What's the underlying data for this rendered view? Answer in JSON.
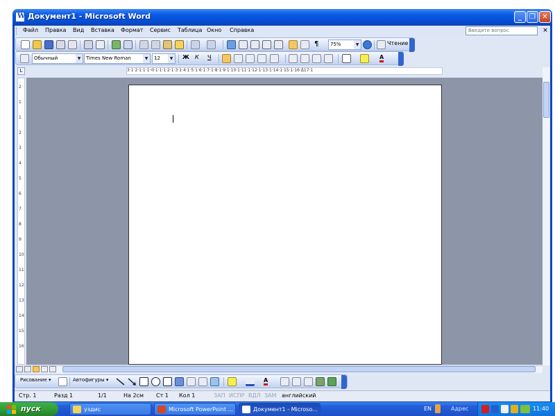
{
  "window": {
    "title": "Документ1 - Microsoft Word",
    "controls": [
      "minimize",
      "restore",
      "close"
    ]
  },
  "menu": {
    "items": [
      "Файл",
      "Правка",
      "Вид",
      "Вставка",
      "Формат",
      "Сервис",
      "Таблица",
      "Окно",
      "Справка"
    ],
    "help_placeholder": "Введите вопрос",
    "close_doc": "×"
  },
  "standard_toolbar": {
    "zoom": "75%",
    "reading_label": "Чтение",
    "pilcrow": "¶"
  },
  "formatting_toolbar": {
    "style": "Обычный",
    "font": "Times New Roman",
    "size": "12",
    "bold": "Ж",
    "italic": "К",
    "underline": "Ч",
    "font_color_glyph": "A"
  },
  "ruler": {
    "tab_selector": "L",
    "horizontal": "3·1·2·1·1·1·ᐊ·1·1·1·2·1·3·1·4·1·5·1·6·1·7·1·8·1·9·1·10·1·11·1·12·1·13·1·14·1·15·1·16·ᐃ17·1",
    "vertical_labels": [
      "2",
      "1",
      "1",
      "2",
      "3",
      "4",
      "5",
      "6",
      "7",
      "8",
      "9",
      "10",
      "11",
      "12",
      "13",
      "14",
      "15",
      "16"
    ]
  },
  "drawing_toolbar": {
    "draw_label": "Рисование ▾",
    "autoshapes_label": "Автофигуры ▾"
  },
  "status_bar": {
    "page": "Стр. 1",
    "section": "Разд 1",
    "pages": "1/1",
    "at": "На 2см",
    "line": "Ст 1",
    "col": "Кол 1",
    "rec": "ЗАП",
    "trk": "ИСПР",
    "ext": "ВДЛ",
    "ovr": "ЗАМ",
    "language": "английский"
  },
  "taskbar": {
    "start_label": "пуск",
    "tasks": [
      {
        "label": "уздис",
        "active": false
      },
      {
        "label": "Microsoft PowerPoint ...",
        "active": false
      },
      {
        "label": "Документ1 - Microso...",
        "active": true
      }
    ],
    "lang": "EN",
    "address_label": "Адрес",
    "time": "11:40"
  },
  "colors": {
    "title_blue": "#0550d8",
    "taskbar_blue": "#245edb",
    "start_green": "#2e9a34",
    "workspace_gray": "#8c96a8",
    "toolbar_end": "#3266cc"
  }
}
